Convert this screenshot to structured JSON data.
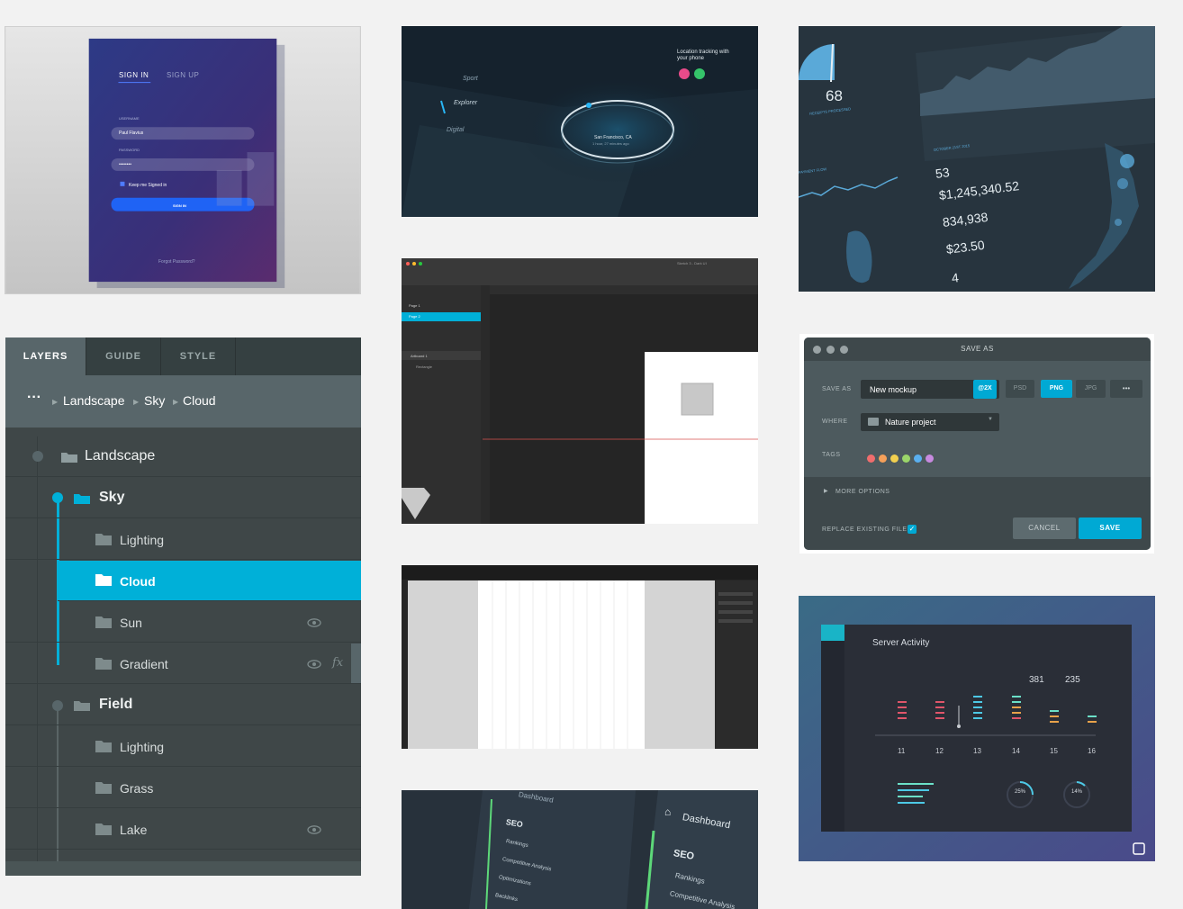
{
  "layers_panel": {
    "tabs": [
      "LAYERS",
      "GUIDE",
      "STYLE"
    ],
    "breadcrumb": {
      "more": "···",
      "items": [
        "Landscape",
        "Sky",
        "Cloud"
      ]
    },
    "tree": [
      {
        "label": "Landscape",
        "level": 0,
        "kind": "group"
      },
      {
        "label": "Sky",
        "level": 1,
        "kind": "group",
        "expanded": true
      },
      {
        "label": "Lighting",
        "level": 2,
        "kind": "layer"
      },
      {
        "label": "Cloud",
        "level": 2,
        "kind": "layer",
        "selected": true
      },
      {
        "label": "Sun",
        "level": 2,
        "kind": "layer",
        "icons": [
          "eye-icon"
        ]
      },
      {
        "label": "Gradient",
        "level": 2,
        "kind": "layer",
        "icons": [
          "eye-icon",
          "fx-icon"
        ],
        "fx": "fx"
      },
      {
        "label": "Field",
        "level": 1,
        "kind": "group"
      },
      {
        "label": "Lighting",
        "level": 2,
        "kind": "layer"
      },
      {
        "label": "Grass",
        "level": 2,
        "kind": "layer"
      },
      {
        "label": "Lake",
        "level": 2,
        "kind": "layer",
        "icons": [
          "eye-icon"
        ]
      }
    ]
  },
  "signin_card": {
    "tabs": [
      "SIGN IN",
      "SIGN UP"
    ],
    "username_label": "USERNAME",
    "username_value": "Paul Flavius",
    "password_label": "PASSWORD",
    "password_value": "••••••••",
    "remember": "Keep me Signed in",
    "button": "SIGN IN",
    "forgot": "Forgot Password?"
  },
  "map_card": {
    "items": [
      "Sport",
      "Explorer",
      "Digital"
    ],
    "tracking": "Location tracking with your phone",
    "location": "San Francisco, CA",
    "time": "1 hour, 27 minutes ago"
  },
  "sketch_card": {
    "title": "Sketch 3 - Dark UI",
    "pages": [
      "Page 1",
      "Page 2"
    ],
    "artboard": "Artboard 1",
    "layer": "Rectangle"
  },
  "stats_card": {
    "gauge_value": "68",
    "gauge_label": "RECEIPTS PROCESSED",
    "date": "OCTOBER 21ST 2015",
    "flow_label": "PAYMENT FLOW",
    "stats": [
      "53",
      "$1,245,340.52",
      "834,938",
      "$23.50",
      "4"
    ]
  },
  "save_as": {
    "title": "SAVE AS",
    "save_as_label": "SAVE AS",
    "file_name": "New mockup",
    "scale": "@2X",
    "formats": [
      "PSD",
      "PNG",
      "JPG"
    ],
    "selected_format": "PNG",
    "more": "•••",
    "where_label": "WHERE",
    "where_value": "Nature project",
    "tags_label": "TAGS",
    "tag_colors": [
      "#f06d6d",
      "#f5a05a",
      "#f2d04f",
      "#9bd66a",
      "#5ab0f0",
      "#c88ae0"
    ],
    "more_options": "MORE OPTIONS",
    "replace_label": "REPLACE EXISTING FILE",
    "cancel": "CANCEL",
    "save": "SAVE"
  },
  "server_card": {
    "title": "Server Activity",
    "values": [
      "381",
      "235"
    ],
    "days": [
      "11",
      "12",
      "13",
      "14",
      "15",
      "16"
    ],
    "rings": [
      "25%",
      "14%"
    ]
  },
  "seo_card": {
    "left_title": "Dashboard",
    "left_section": "SEO",
    "left_items": [
      "Rankings",
      "Competitive Analysis",
      "Optimizations",
      "Backlinks"
    ],
    "right_title": "Dashboard",
    "right_section": "SEO",
    "right_items": [
      "Rankings",
      "Competitive Analysis"
    ]
  },
  "colors": {
    "accent": "#00b0d8",
    "panel": "#3f4748",
    "page_bg": "#f2f2f2"
  }
}
